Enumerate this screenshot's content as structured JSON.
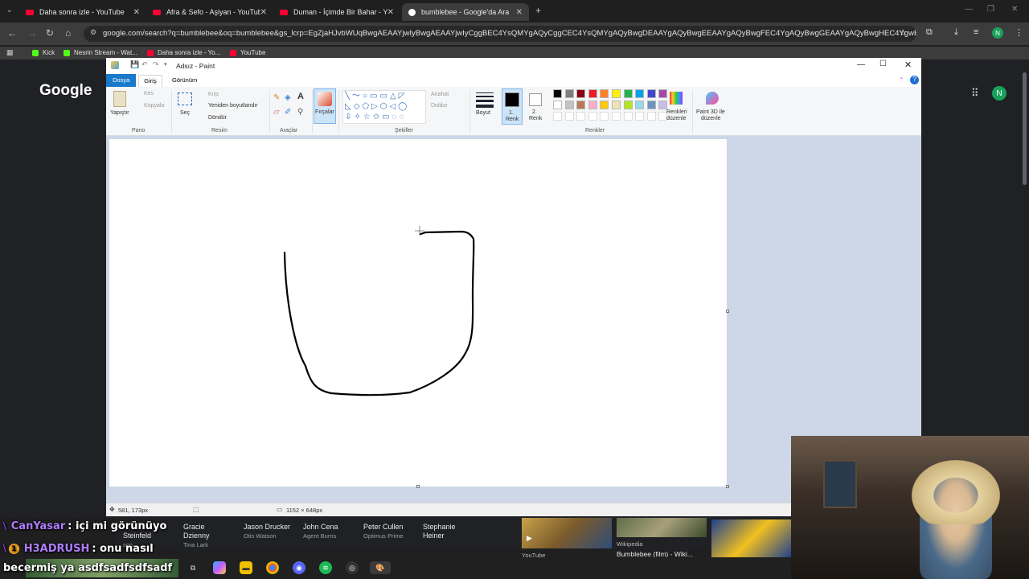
{
  "browser": {
    "tabs": [
      {
        "label": "Daha sonra izle - YouTube",
        "active": false
      },
      {
        "label": "Afra & Sefo - Aşiyan - YouTube",
        "active": false
      },
      {
        "label": "Duman - İçimde Bir Bahar - Yo...",
        "active": false
      },
      {
        "label": "bumblebee - Google'da Ara",
        "active": true
      }
    ],
    "url": "google.com/search?q=bumblebee&oq=bumblebee&gs_lcrp=EgZjaHJvbWUqBwgAEAAYjwIyBwgAEAAYjwIyCggBEC4YsQMYgAQyCggCEC4YsQMYgAQyBwgDEAAYgAQyBwgEEAAYgAQyBwgFEC4YgAQyBwgGEAAYgAQyBwgHEC4YgwEY1AIYs...",
    "bookmarks": [
      "Kick",
      "Nesrin Stream - Wat...",
      "Daha sonra izle - Yo...",
      "YouTube"
    ],
    "profile_initial": "N"
  },
  "google": {
    "logo": "Google"
  },
  "paint": {
    "title": "Adsız - Paint",
    "tabs": {
      "file": "Dosya",
      "home": "Giriş",
      "view": "Görünüm"
    },
    "clipboard": {
      "paste": "Yapıştır",
      "cut": "Kes",
      "copy": "Kopyala",
      "group": "Pano"
    },
    "image": {
      "select": "Seç",
      "crop": "Kırp",
      "resize": "Yeniden boyutlandır",
      "rotate": "Döndür",
      "group": "Resim"
    },
    "tools": {
      "group": "Araçlar",
      "text": "A"
    },
    "brushes": "Fırçalar",
    "shapes": {
      "outline": "Anahat",
      "fill": "Doldur",
      "group": "Şekiller"
    },
    "size": "Boyut",
    "color1": {
      "line1": "1.",
      "line2": "Renk"
    },
    "color2": {
      "line1": "2.",
      "line2": "Renk"
    },
    "colors_group": "Renkler",
    "edit_colors": {
      "line1": "Renkleri",
      "line2": "düzenle"
    },
    "paint3d": {
      "line1": "Paint 3D ile",
      "line2": "düzenle"
    },
    "status": {
      "cursor": "581, 173px",
      "canvas_size": "1152 × 648px"
    }
  },
  "palette": [
    "#000000",
    "#7f7f7f",
    "#880015",
    "#ed1c24",
    "#ff7f27",
    "#fff200",
    "#22b14c",
    "#00a2e8",
    "#3f48cc",
    "#a349a4",
    "#ffffff",
    "#c3c3c3",
    "#b97a57",
    "#ffaec9",
    "#ffc90e",
    "#efe4b0",
    "#b5e61d",
    "#99d9ea",
    "#7092be",
    "#c8bfe7"
  ],
  "search_results": [
    {
      "name": "Gracie Dzienny",
      "role": "Tina Lark"
    },
    {
      "name": "Jason Drucker",
      "role": "Otis Watson"
    },
    {
      "name": "John Cena",
      "role": "Agent Burns"
    },
    {
      "name": "Peter Cullen",
      "role": "Optimus Prime"
    },
    {
      "name": "Stephanie Heiner",
      "role": ""
    }
  ],
  "partial_person": {
    "name": "Steinfeld",
    "role": "son"
  },
  "media_cards": {
    "youtube": "YouTube",
    "wiki_source": "Wikipedia",
    "wiki_title": "Bumblebee (film) - Wiki..."
  },
  "chat": [
    {
      "user": "CanYasar",
      "text": ": içi mi görünüyo"
    },
    {
      "user": "H3ADRUSH",
      "text": ": onu nasıl"
    },
    {
      "user": "",
      "text": "becermiş ya asdfsadfsdfsadf"
    }
  ]
}
